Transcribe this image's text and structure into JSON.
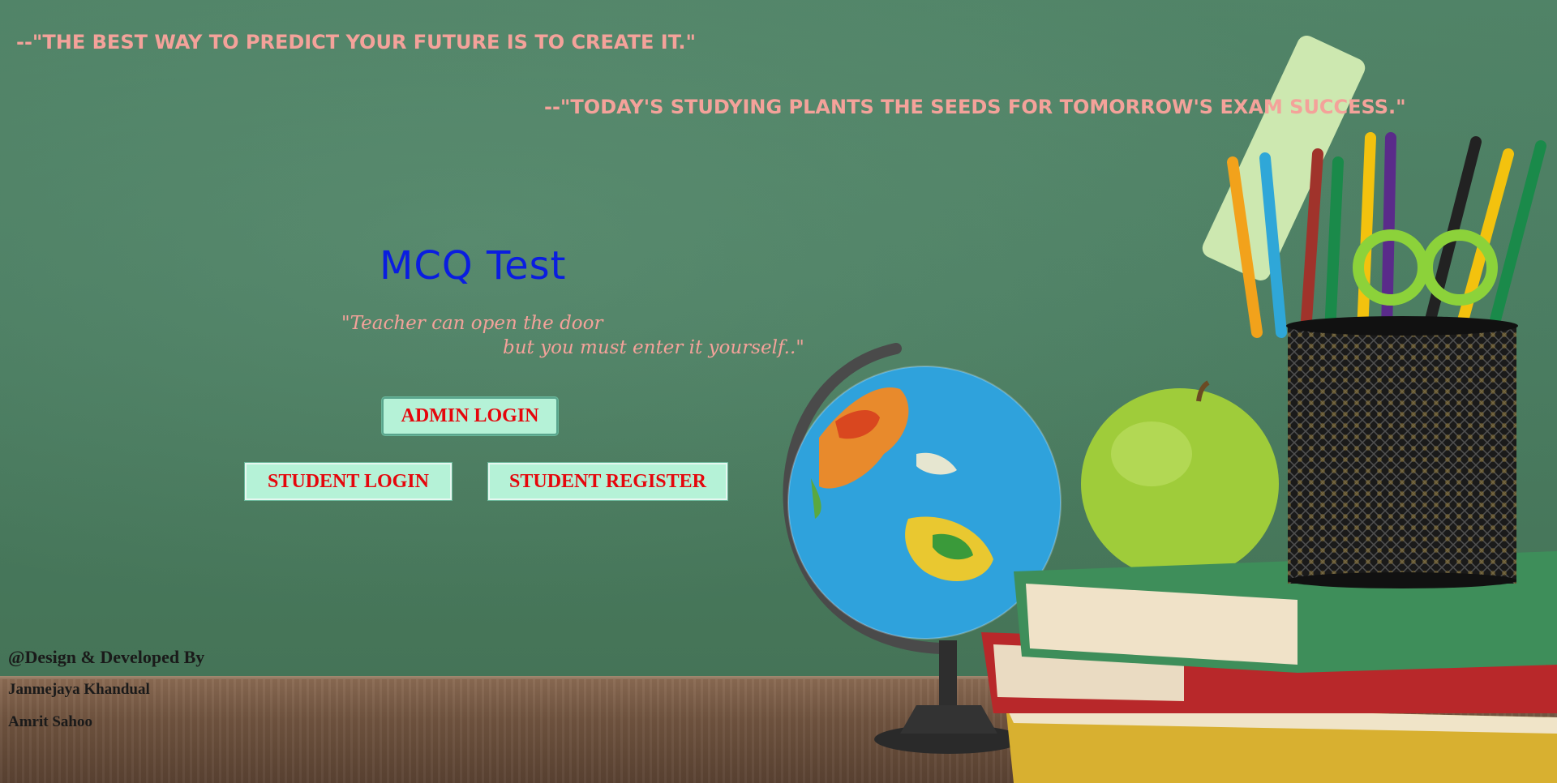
{
  "quotes": [
    "--\"THE BEST WAY TO PREDICT YOUR FUTURE IS TO CREATE IT.\"",
    "--\"TODAY'S STUDYING PLANTS THE SEEDS FOR TOMORROW'S EXAM SUCCESS.\""
  ],
  "main": {
    "title": "MCQ Test",
    "tagline_line1": "\"Teacher can open the door",
    "tagline_line2": "but you must enter it yourself..\"",
    "admin_login_label": "ADMIN LOGIN",
    "student_login_label": "STUDENT LOGIN",
    "student_register_label": "STUDENT REGISTER"
  },
  "footer": {
    "heading": "@Design & Developed By",
    "developers": [
      "Janmejaya Khandual",
      "Amrit Sahoo"
    ]
  },
  "colors": {
    "quote": "#f4a29a",
    "title": "#0a1de0",
    "button_bg": "#b5f2d7",
    "button_text": "#e5060c",
    "chalkboard": "#4a7c61"
  },
  "illustration": {
    "objects": [
      "globe-icon",
      "apple-icon",
      "book-stack-icon",
      "pencil-cup-icon",
      "scissors-icon",
      "ruler-icon"
    ]
  }
}
